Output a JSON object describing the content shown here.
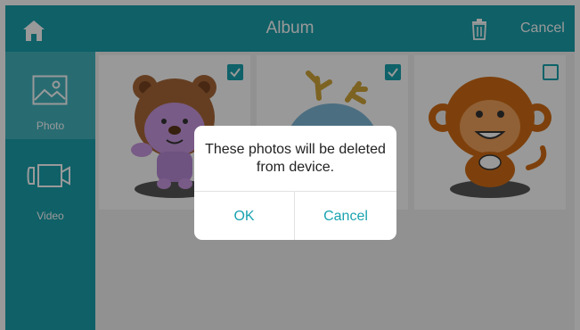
{
  "header": {
    "title": "Album",
    "cancel_label": "Cancel",
    "icons": {
      "home": "home-icon",
      "delete": "trash-icon"
    }
  },
  "sidebar": {
    "items": [
      {
        "label": "Photo",
        "icon": "image-icon",
        "selected": true
      },
      {
        "label": "Video",
        "icon": "video-camera-icon",
        "selected": false
      }
    ]
  },
  "photos": [
    {
      "subject": "bear",
      "selected": true
    },
    {
      "subject": "dragon",
      "selected": true
    },
    {
      "subject": "monkey",
      "selected": false
    }
  ],
  "dialog": {
    "message": "These photos will be deleted from device.",
    "ok_label": "OK",
    "cancel_label": "Cancel"
  },
  "colors": {
    "accent": "#1aa0ac",
    "sidebar_selected": "#43b4be",
    "button_text": "#19a3b0"
  }
}
